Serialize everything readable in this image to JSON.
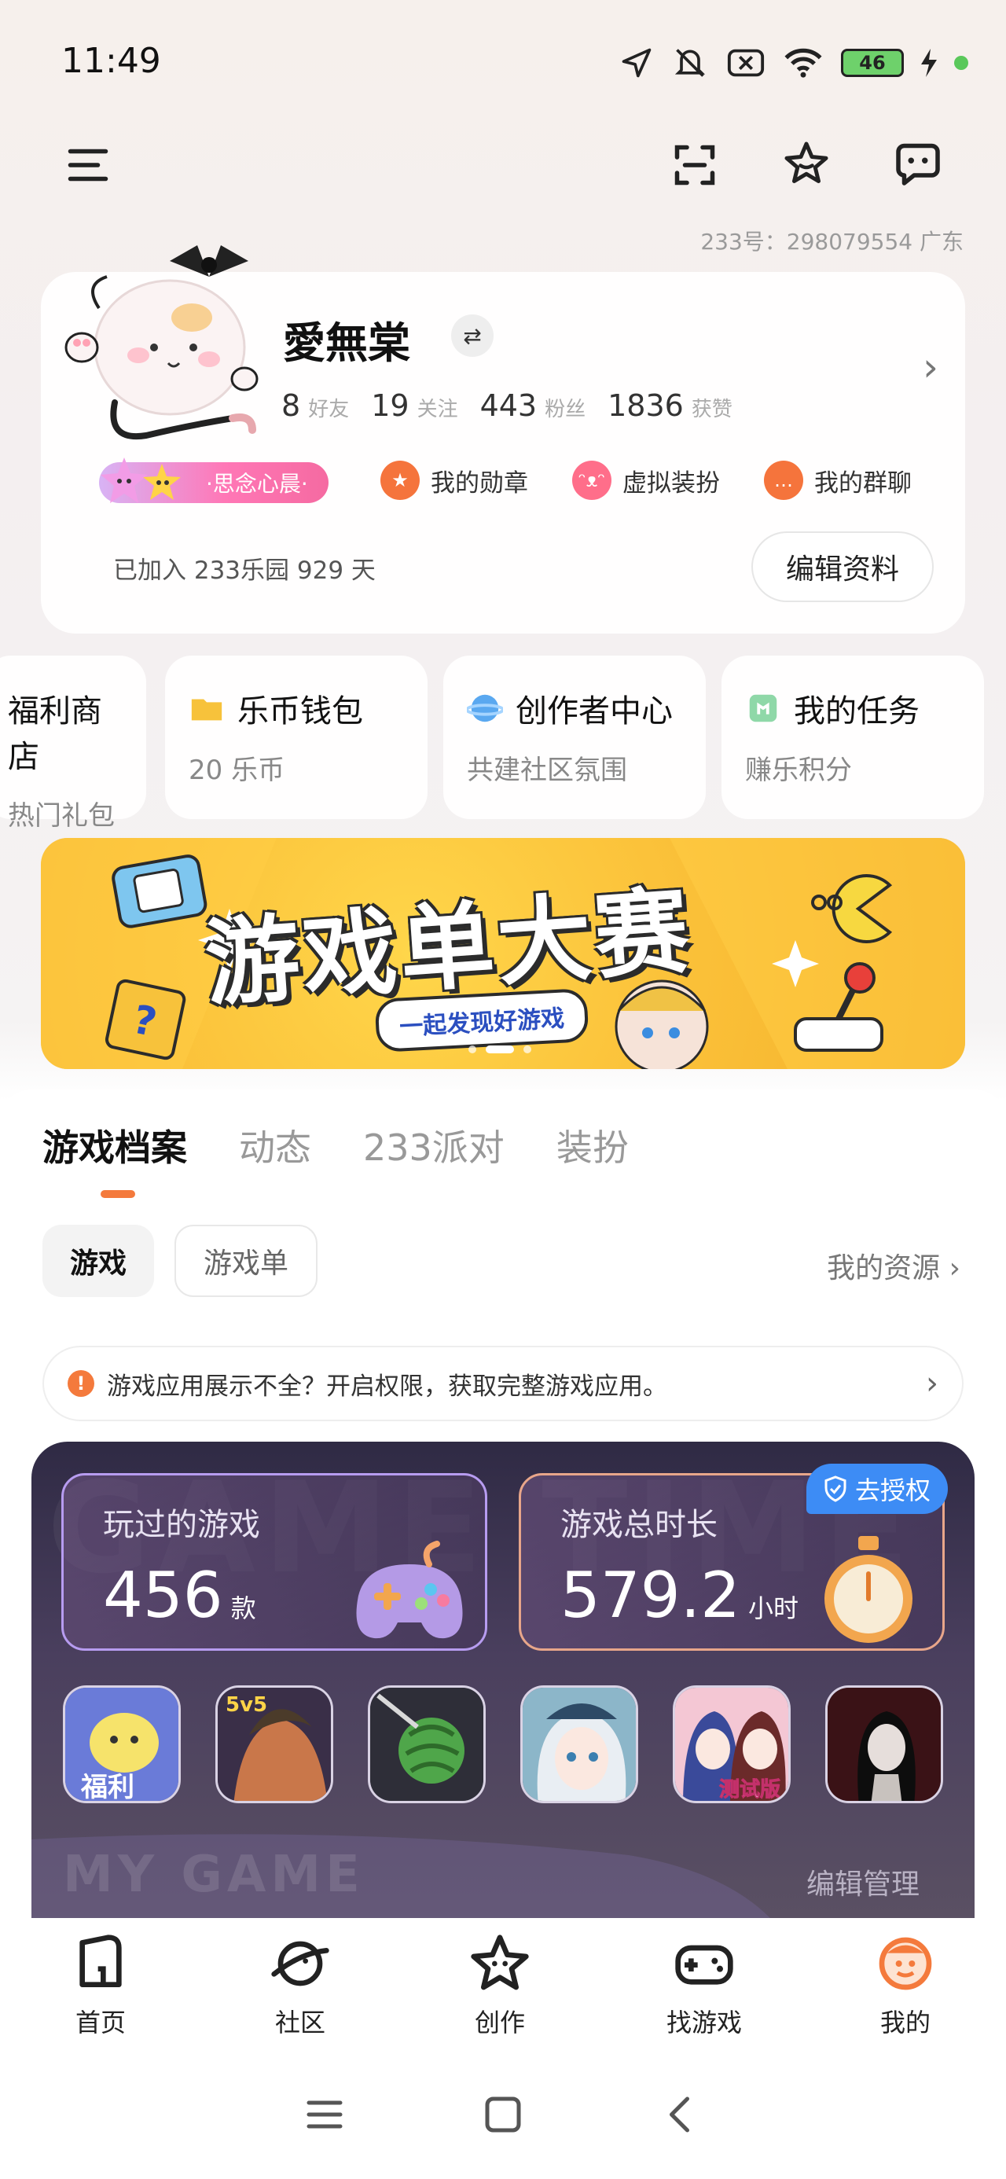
{
  "status_bar": {
    "time": "11:49",
    "battery": "46",
    "icons": [
      "location-icon",
      "mute-icon",
      "sim-off-icon",
      "wifi-icon",
      "battery-icon",
      "charging-icon"
    ]
  },
  "header": {
    "icons": [
      "menu-icon",
      "scan-icon",
      "star-icon",
      "message-icon"
    ],
    "id_line": "233号：298079554   广东"
  },
  "profile": {
    "username": "愛無棠",
    "swap_icon": "⇄",
    "stats": [
      {
        "num": "8",
        "label": "好友"
      },
      {
        "num": "19",
        "label": "关注"
      },
      {
        "num": "443",
        "label": "粉丝"
      },
      {
        "num": "1836",
        "label": "获赞"
      }
    ],
    "title_badge": "·思念心晨·",
    "shortcuts": [
      {
        "label": "我的勋章",
        "icon": "medal-icon",
        "color": "#f5743c"
      },
      {
        "label": "虚拟装扮",
        "icon": "dressup-icon",
        "color": "#ff6e8a"
      },
      {
        "label": "我的群聊",
        "icon": "group-chat-icon",
        "color": "#f5743c"
      }
    ],
    "joined": "已加入 233乐园 929 天",
    "edit_button": "编辑资料"
  },
  "quick_cards": [
    {
      "title": "福利商店",
      "sub": "热门礼包",
      "icon": "gift-icon",
      "color": "#ff8a7a"
    },
    {
      "title": "乐币钱包",
      "sub": "20 乐币",
      "icon": "wallet-icon",
      "color": "#f7c23b"
    },
    {
      "title": "创作者中心",
      "sub": "共建社区氛围",
      "icon": "creator-icon",
      "color": "#5aa8f0"
    },
    {
      "title": "我的任务",
      "sub": "赚乐积分",
      "icon": "task-icon",
      "color": "#6cc88a"
    }
  ],
  "banner": {
    "title": "游戏单大赛",
    "subtitle": "一起发现好游戏"
  },
  "tabs": [
    {
      "label": "游戏档案",
      "active": true
    },
    {
      "label": "动态",
      "active": false
    },
    {
      "label": "233派对",
      "active": false
    },
    {
      "label": "装扮",
      "active": false
    }
  ],
  "filters": {
    "games": "游戏",
    "game_list": "游戏单",
    "resources": "我的资源 ›"
  },
  "notice": {
    "icon": "!",
    "text": "游戏应用展示不全？开启权限，获取完整游戏应用。"
  },
  "game_panel": {
    "bg_text": "GAME TIME",
    "played": {
      "label": "玩过的游戏",
      "value": "456",
      "unit": "款"
    },
    "duration": {
      "label": "游戏总时长",
      "value": "579.2",
      "unit": "小时"
    },
    "authorize": "去授权",
    "footer_text": "MY GAME",
    "edit_manage": "编辑管理",
    "games": [
      {
        "icon": "game-fuli-icon",
        "label": "福利",
        "colors": [
          "#6a7bd8",
          "#f6e36b"
        ]
      },
      {
        "icon": "game-5v5-icon",
        "label": "5v5",
        "colors": [
          "#c9774a",
          "#3a2f48"
        ]
      },
      {
        "icon": "game-watermelon-icon",
        "label": "",
        "colors": [
          "#2e2e38",
          "#4fa64a"
        ]
      },
      {
        "icon": "game-anime-girl-icon",
        "label": "",
        "colors": [
          "#8cb6c9",
          "#e9eef3"
        ]
      },
      {
        "icon": "game-sakura-icon",
        "label": "测试版",
        "colors": [
          "#6a8fd6",
          "#f4c7d4"
        ]
      },
      {
        "icon": "game-horror-icon",
        "label": "",
        "colors": [
          "#3a1216",
          "#c8c2be"
        ]
      }
    ]
  },
  "bottom_nav": [
    {
      "label": "首页",
      "icon": "home-icon"
    },
    {
      "label": "社区",
      "icon": "planet-icon"
    },
    {
      "label": "创作",
      "icon": "create-star-icon"
    },
    {
      "label": "找游戏",
      "icon": "gamepad-icon"
    },
    {
      "label": "我的",
      "icon": "profile-icon",
      "active": true
    }
  ],
  "system_nav": [
    "recent-apps-icon",
    "home-square-icon",
    "back-icon"
  ]
}
